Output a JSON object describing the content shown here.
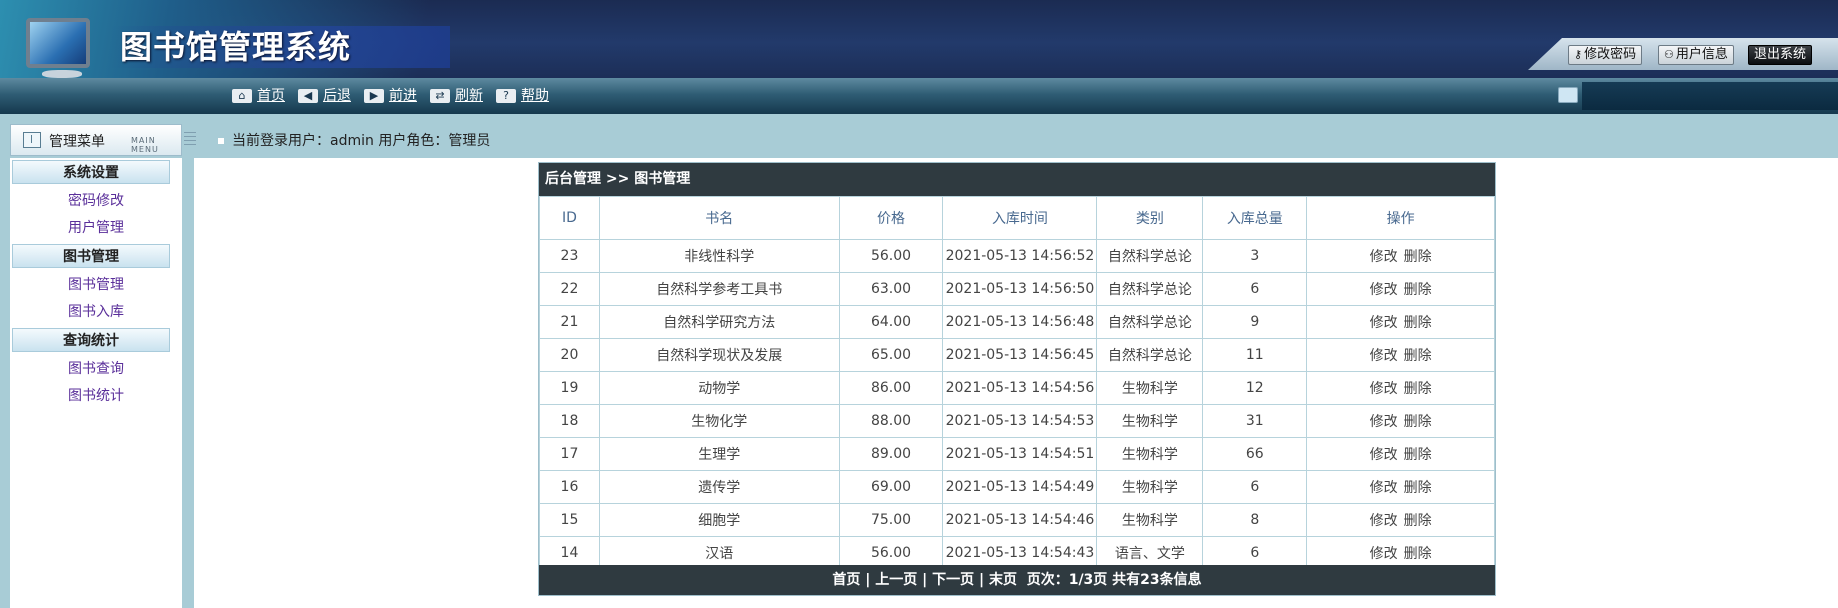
{
  "header": {
    "app_title": "图书馆管理系统",
    "actions": {
      "change_password": "修改密码",
      "user_info": "用户信息",
      "logout": "退出系统"
    }
  },
  "nav": {
    "items": [
      {
        "label": "首页",
        "icon": "home-icon",
        "glyph": "⌂"
      },
      {
        "label": "后退",
        "icon": "back-arrow-icon",
        "glyph": "◀"
      },
      {
        "label": "前进",
        "icon": "forward-arrow-icon",
        "glyph": "▶"
      },
      {
        "label": "刷新",
        "icon": "refresh-icon",
        "glyph": "⇄"
      },
      {
        "label": "帮助",
        "icon": "help-icon",
        "glyph": "?"
      }
    ]
  },
  "menu": {
    "title": "管理菜单",
    "subtitle": "MAIN MENU",
    "groups": [
      {
        "label": "系统设置",
        "items": [
          "密码修改",
          "用户管理"
        ]
      },
      {
        "label": "图书管理",
        "items": [
          "图书管理",
          "图书入库"
        ]
      },
      {
        "label": "查询统计",
        "items": [
          "图书查询",
          "图书统计"
        ]
      }
    ]
  },
  "status": {
    "user_line": "当前登录用户：admin  用户角色：管理员"
  },
  "panel": {
    "breadcrumb": "后台管理 >> 图书管理",
    "columns": [
      "ID",
      "书名",
      "价格",
      "入库时间",
      "类别",
      "入库总量",
      "操作"
    ],
    "op_edit": "修改",
    "op_delete": "删除",
    "rows": [
      [
        "23",
        "非线性科学",
        "56.00",
        "2021-05-13 14:56:52",
        "自然科学总论",
        "3"
      ],
      [
        "22",
        "自然科学参考工具书",
        "63.00",
        "2021-05-13 14:56:50",
        "自然科学总论",
        "6"
      ],
      [
        "21",
        "自然科学研究方法",
        "64.00",
        "2021-05-13 14:56:48",
        "自然科学总论",
        "9"
      ],
      [
        "20",
        "自然科学现状及发展",
        "65.00",
        "2021-05-13 14:56:45",
        "自然科学总论",
        "11"
      ],
      [
        "19",
        "动物学",
        "86.00",
        "2021-05-13 14:54:56",
        "生物科学",
        "12"
      ],
      [
        "18",
        "生物化学",
        "88.00",
        "2021-05-13 14:54:53",
        "生物科学",
        "31"
      ],
      [
        "17",
        "生理学",
        "89.00",
        "2021-05-13 14:54:51",
        "生物科学",
        "66"
      ],
      [
        "16",
        "遗传学",
        "69.00",
        "2021-05-13 14:54:49",
        "生物科学",
        "6"
      ],
      [
        "15",
        "细胞学",
        "75.00",
        "2021-05-13 14:54:46",
        "生物科学",
        "8"
      ],
      [
        "14",
        "汉语",
        "56.00",
        "2021-05-13 14:54:43",
        "语言、文学",
        "6"
      ]
    ],
    "pager": {
      "first": "首页",
      "prev": "上一页",
      "next": "下一页",
      "last": "末页",
      "info": "页次：1/3页 共有23条信息"
    }
  }
}
